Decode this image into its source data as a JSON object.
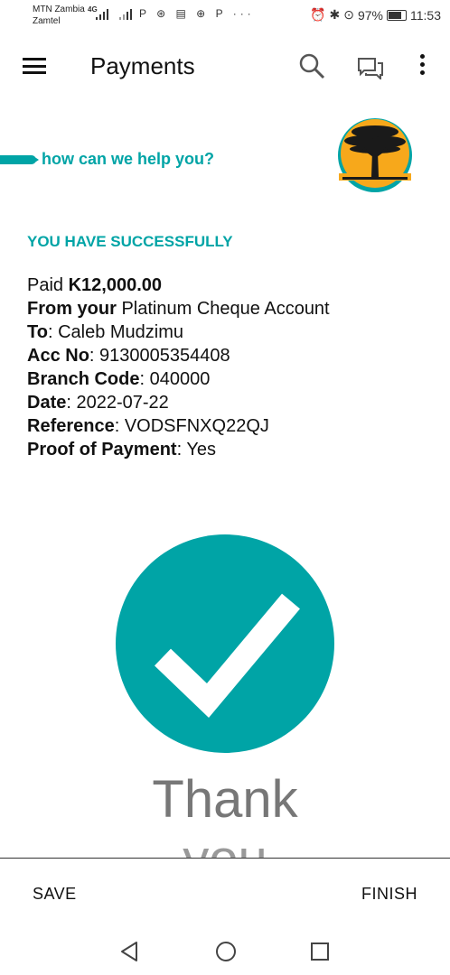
{
  "status_bar": {
    "carrier1": "MTN Zambia",
    "carrier2": "Zamtel",
    "network": "4G",
    "app_icons": "P ⊛ ▤ ⊕ P ···",
    "battery": "97%",
    "time": "11:53"
  },
  "app_bar": {
    "title": "Payments",
    "icons": [
      "menu-icon",
      "search-icon",
      "chat-icon",
      "more-icon"
    ]
  },
  "brand": {
    "tagline": "how can we help you?",
    "accent_color": "#00a4a6",
    "logo_color": "#f7a81b"
  },
  "confirmation": {
    "heading": "YOU HAVE SUCCESSFULLY",
    "paid_label": "Paid",
    "amount": "K12,000.00",
    "from_label": "From your",
    "from_value": "Platinum Cheque Account",
    "to_label": "To",
    "to_value": ": Caleb Mudzimu",
    "acc_label": "Acc No",
    "acc_value": ": 9130005354408",
    "branch_label": "Branch Code",
    "branch_value": ": 040000",
    "date_label": "Date",
    "date_value": ": 2022-07-22",
    "ref_label": "Reference",
    "ref_value": ": VODSFNXQ22QJ",
    "pop_label": "Proof of Payment",
    "pop_value": ": Yes"
  },
  "thank_you": {
    "line1": "Thank",
    "line2": "you"
  },
  "actions": {
    "save": "SAVE",
    "finish": "FINISH"
  }
}
